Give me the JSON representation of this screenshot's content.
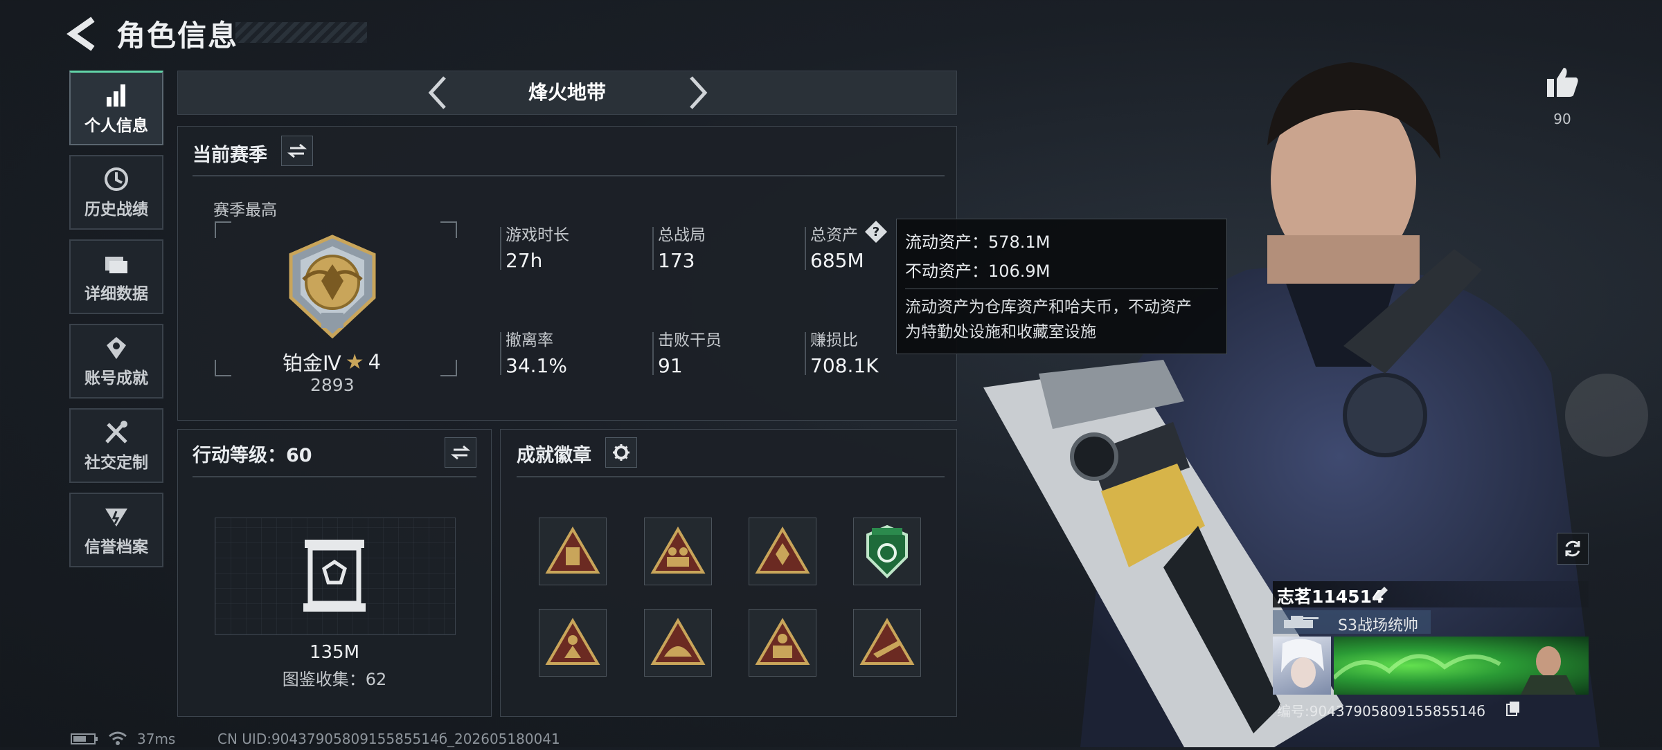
{
  "header": {
    "title": "角色信息"
  },
  "nav": [
    {
      "label": "个人信息",
      "icon": "bar-chart-icon",
      "active": true
    },
    {
      "label": "历史战绩",
      "icon": "history-clock-icon"
    },
    {
      "label": "详细数据",
      "icon": "folder-icon"
    },
    {
      "label": "账号成就",
      "icon": "achievement-icon"
    },
    {
      "label": "社交定制",
      "icon": "tools-icon"
    },
    {
      "label": "信誉档案",
      "icon": "reputation-icon"
    }
  ],
  "mode": {
    "title": "烽火地带"
  },
  "season": {
    "title": "当前赛季",
    "best_label": "赛季最高",
    "rank_name": "铂金Ⅳ",
    "rank_stars": "4",
    "rank_score": "2893",
    "stats": [
      {
        "label": "游戏时长",
        "value": "27h"
      },
      {
        "label": "总战局",
        "value": "173"
      },
      {
        "label": "总资产",
        "value": "685M"
      },
      {
        "label": "撤离率",
        "value": "34.1%"
      },
      {
        "label": "击败干员",
        "value": "91"
      },
      {
        "label": "赚损比",
        "value": "708.1K"
      }
    ]
  },
  "tooltip": {
    "liquid": "流动资产：578.1M",
    "fixed": "不动资产：106.9M",
    "desc_1": "流动资产为仓库资产和哈夫币，不动资产",
    "desc_2": "为特勤处设施和收藏室设施"
  },
  "action_level": {
    "title": "行动等级：60",
    "value": "135M",
    "collection": "图鉴收集：62"
  },
  "achievements": {
    "title": "成就徽章",
    "badges": [
      "supply-badge",
      "team-badge",
      "hands-badge",
      "shield-badge",
      "soldier-badge",
      "tent-badge",
      "number-55-badge",
      "weapon-badge"
    ]
  },
  "likes": {
    "count": "90"
  },
  "player": {
    "name": "志茗114514",
    "title": "S3战场统帅",
    "id_text": "编号:9043790580915585514б"
  },
  "footer": {
    "ping": "37ms",
    "uid": "CN UID:9043790580915585514б_202605180041"
  },
  "colors": {
    "accent": "#62d5a9",
    "gold": "#c9a55a",
    "green": "#3ecf53"
  }
}
